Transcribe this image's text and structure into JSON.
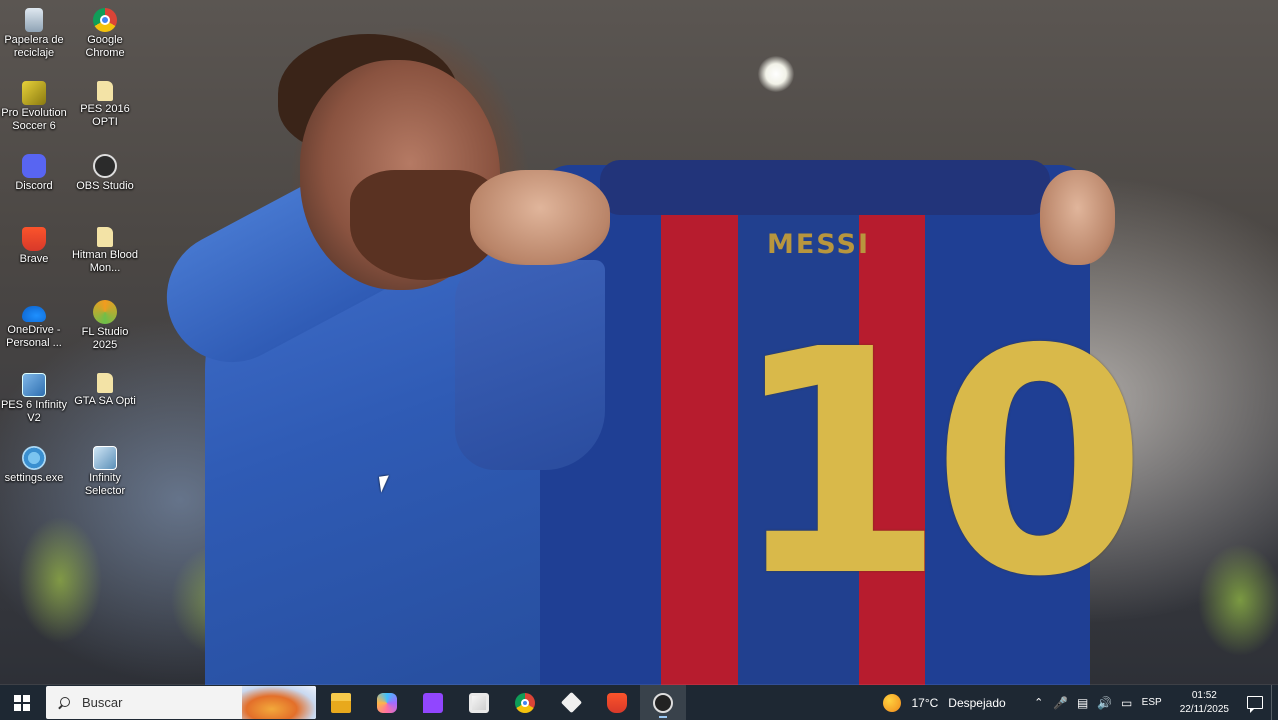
{
  "wallpaper": {
    "shirt_name": "MESSI",
    "shirt_number": "10"
  },
  "desktop_icons": [
    {
      "label": "Papelera de reciclaje",
      "icon": "recycle-bin-icon"
    },
    {
      "label": "Google Chrome",
      "icon": "chrome-icon"
    },
    {
      "label": "Pro Evolution Soccer 6",
      "icon": "pes6-game-icon"
    },
    {
      "label": "PES 2016 OPTI",
      "icon": "folder-file-icon"
    },
    {
      "label": "Discord",
      "icon": "discord-icon"
    },
    {
      "label": "OBS Studio",
      "icon": "obs-icon"
    },
    {
      "label": "Brave",
      "icon": "brave-icon"
    },
    {
      "label": "Hitman Blood Mon...",
      "icon": "folder-file-icon"
    },
    {
      "label": "OneDrive - Personal ...",
      "icon": "onedrive-icon"
    },
    {
      "label": "FL Studio 2025",
      "icon": "fl-studio-icon"
    },
    {
      "label": "PES 6 Infinity V2",
      "icon": "pes6-infinity-icon"
    },
    {
      "label": "GTA SA Opti",
      "icon": "folder-file-icon"
    },
    {
      "label": "settings.exe",
      "icon": "settings-exe-icon"
    },
    {
      "label": "Infinity Selector",
      "icon": "infinity-selector-icon"
    }
  ],
  "taskbar": {
    "search_placeholder": "Buscar",
    "apps": [
      {
        "name": "file-explorer",
        "icon": "folder-icon"
      },
      {
        "name": "copilot",
        "icon": "copilot-icon"
      },
      {
        "name": "twitch",
        "icon": "twitch-icon"
      },
      {
        "name": "microsoft-store",
        "icon": "store-icon"
      },
      {
        "name": "google-chrome",
        "icon": "chrome-icon"
      },
      {
        "name": "capcut",
        "icon": "capcut-icon"
      },
      {
        "name": "brave",
        "icon": "brave-icon"
      },
      {
        "name": "obs-studio",
        "icon": "obs-icon"
      }
    ],
    "weather": {
      "temp": "17°C",
      "condition": "Despejado"
    },
    "language": "ESP",
    "time": "01:52",
    "date": "22/11/2025"
  }
}
